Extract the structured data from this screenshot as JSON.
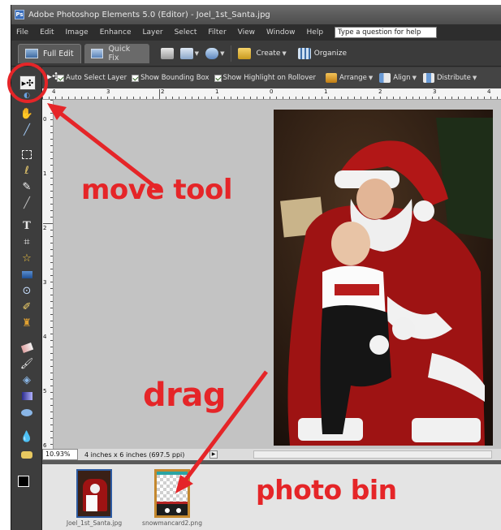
{
  "window": {
    "title": "Adobe Photoshop Elements 5.0 (Editor) - Joel_1st_Santa.jpg"
  },
  "menubar": {
    "items": [
      "File",
      "Edit",
      "Image",
      "Enhance",
      "Layer",
      "Select",
      "Filter",
      "View",
      "Window",
      "Help"
    ],
    "help_search_value": "Type a question for help"
  },
  "modebar": {
    "full_edit": "Full Edit",
    "quick_fix": "Quick Fix",
    "create": "Create",
    "organize": "Organize"
  },
  "options": {
    "auto_select": "Auto Select Layer",
    "bounding_box": "Show Bounding Box",
    "highlight": "Show Highlight on Rollover",
    "arrange": "Arrange",
    "align": "Align",
    "distribute": "Distribute"
  },
  "ruler": {
    "top": [
      "4",
      "3",
      "2",
      "1",
      "0",
      "1",
      "2",
      "3",
      "4"
    ],
    "left": [
      "0",
      "1",
      "2",
      "3",
      "4",
      "5",
      "6"
    ]
  },
  "status": {
    "zoom": "10.93%",
    "doc_info": "4 inches x 6 inches (697.5 ppi)"
  },
  "photo_bin": {
    "items": [
      {
        "name": "Joel_1st_Santa.jpg",
        "selected": true
      },
      {
        "name": "snowmancard2.png",
        "selected": false
      }
    ]
  },
  "annotations": {
    "move_tool": "move tool",
    "drag": "drag",
    "photo_bin": "photo bin",
    "color": "#e52528"
  },
  "icons": [
    "move-tool-icon",
    "hand-tool-icon",
    "zoom-tool-icon",
    "eyedropper-icon",
    "marquee-icon",
    "lasso-icon",
    "magic-wand-icon",
    "type-tool-icon",
    "crop-icon",
    "shape-icon",
    "brush-icon",
    "paint-bucket-icon",
    "gradient-icon",
    "blur-icon",
    "sponge-icon"
  ]
}
